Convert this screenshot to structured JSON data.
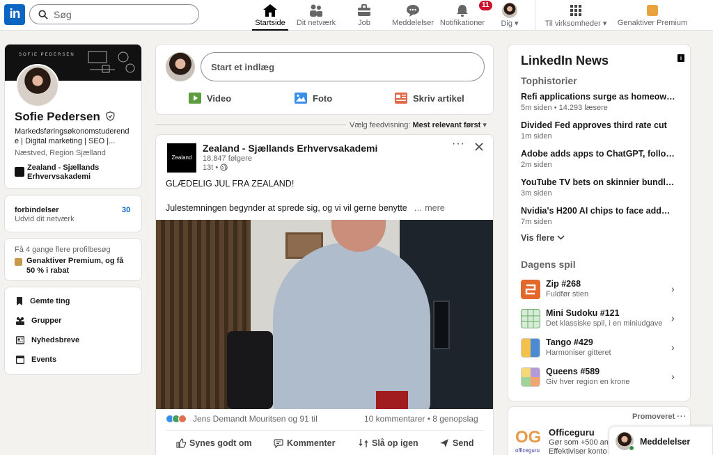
{
  "header": {
    "logo_text": "in",
    "search_placeholder": "Søg",
    "nav": [
      {
        "label": "Startside"
      },
      {
        "label": "Dit netværk"
      },
      {
        "label": "Job"
      },
      {
        "label": "Meddelelser"
      },
      {
        "label": "Notifikationer",
        "badge": "11"
      },
      {
        "label": "Dig"
      },
      {
        "label": "Til virksomheder"
      },
      {
        "label": "Genaktiver Premium"
      }
    ]
  },
  "profile": {
    "banner_text": "SOFIE PEDERSEN",
    "name": "Sofie Pedersen",
    "headline_1": "Markedsføringsøkonomstuderend",
    "headline_2": "e | Digital marketing | SEO |...",
    "location": "Næstved, Region Sjælland",
    "school_1": "Zealand - Sjællands",
    "school_2": "Erhvervsakademi"
  },
  "connections": {
    "label": "forbindelser",
    "count": "30",
    "sub": "Udvid dit netværk"
  },
  "premium_promo": {
    "line": "Få 4 gange flere profilbesøg",
    "cta_1": "Genaktiver Premium, og få",
    "cta_2": "50 % i rabat"
  },
  "left_menu": [
    {
      "label": "Gemte ting"
    },
    {
      "label": "Grupper"
    },
    {
      "label": "Nyhedsbreve"
    },
    {
      "label": "Events"
    }
  ],
  "composer": {
    "placeholder": "Start et indlæg",
    "actions": [
      {
        "label": "Video"
      },
      {
        "label": "Foto"
      },
      {
        "label": "Skriv artikel"
      }
    ]
  },
  "feed_sort": {
    "label": "Vælg feedvisning:",
    "value": "Mest relevant først"
  },
  "post": {
    "logo_text": "Zealand",
    "author": "Zealand - Sjællands Erhvervsakademi",
    "followers": "18.847 følgere",
    "time": "13t •",
    "text_1": "GLÆDELIG JUL FRA ZEALAND!",
    "text_2": "Julestemningen begynder at sprede sig, og vi vil gerne benytte",
    "more": "… mere",
    "reactions": "Jens Demandt Mouritsen og 91 til",
    "comments": "10 kommentarer • 8 genopslag",
    "actions": [
      {
        "label": "Synes godt om"
      },
      {
        "label": "Kommenter"
      },
      {
        "label": "Slå op igen"
      },
      {
        "label": "Send"
      }
    ]
  },
  "news": {
    "title": "LinkedIn News",
    "section": "Tophistorier",
    "items": [
      {
        "headline": "Refi applications surge as homeow…",
        "meta": "5m siden • 14.293 læsere"
      },
      {
        "headline": "Divided Fed approves third rate cut",
        "meta": "1m siden"
      },
      {
        "headline": "Adobe adds apps to ChatGPT, follo…",
        "meta": "2m siden"
      },
      {
        "headline": "YouTube TV bets on skinnier bundl…",
        "meta": "3m siden"
      },
      {
        "headline": "Nvidia's H200 AI chips to face add…",
        "meta": "7m siden"
      }
    ],
    "show_more": "Vis flere"
  },
  "games": {
    "title": "Dagens spil",
    "items": [
      {
        "name": "Zip #268",
        "desc": "Fuldfør stien"
      },
      {
        "name": "Mini Sudoku #121",
        "desc": "Det klassiske spil, i en miniudgave"
      },
      {
        "name": "Tango #429",
        "desc": "Harmoniser gitteret"
      },
      {
        "name": "Queens #589",
        "desc": "Giv hver region en krone"
      }
    ]
  },
  "promo": {
    "label": "Promoveret",
    "brand": "Officeguru",
    "logo_text": "OG",
    "logo_sub": "officeguru",
    "line_1": "Gør som +500 an",
    "line_2": "Effektiviser konto"
  },
  "messaging": {
    "label": "Meddelelser"
  },
  "colors": {
    "brand": "#0a66c2",
    "badge": "#cb112d",
    "background": "#f4f2ee"
  }
}
